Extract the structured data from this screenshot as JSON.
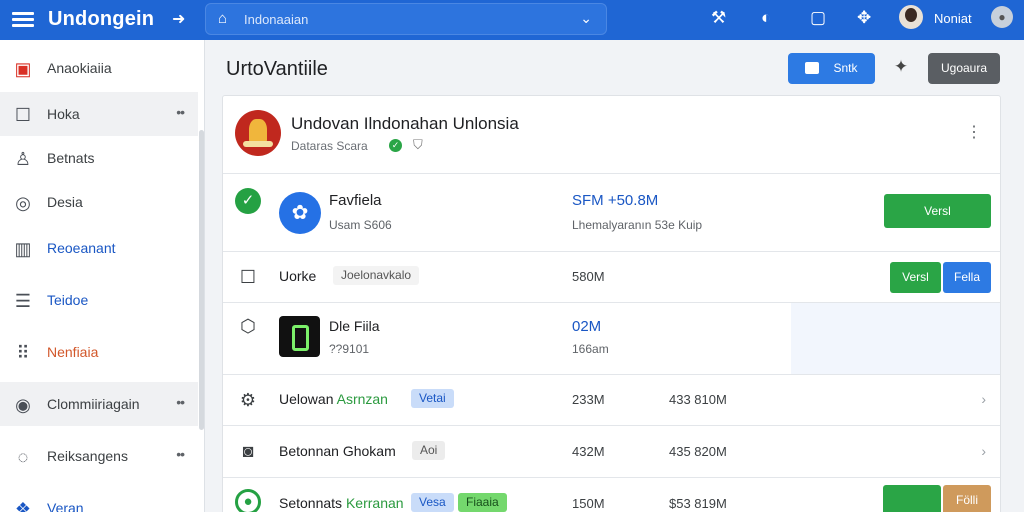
{
  "app": {
    "title": "Undongein",
    "search_text": "Indonaaian",
    "user_name": "Noniat"
  },
  "sidebar": {
    "items": [
      {
        "label": "Anaokiaiia",
        "icon": "flag-icon"
      },
      {
        "label": "Hoka",
        "icon": "square-icon",
        "more": "••"
      },
      {
        "label": "Betnats",
        "icon": "person-icon"
      },
      {
        "label": "Desia",
        "icon": "eye-icon"
      },
      {
        "label": "Reoeanant",
        "icon": "bar-chart-icon"
      },
      {
        "label": "Teidoe",
        "icon": "list-icon"
      },
      {
        "label": "Nenfiaia",
        "icon": "grid-icon"
      },
      {
        "label": "Clommiiriagain",
        "icon": "person-circle-icon",
        "more": "••"
      },
      {
        "label": "Reiksangens",
        "icon": "chat-icon",
        "more": "••"
      },
      {
        "label": "Veran",
        "icon": "tag-icon"
      }
    ]
  },
  "page": {
    "title": "UrtoVantiile",
    "primary_button": "Sntk",
    "dark_button": "Ugoaura"
  },
  "org": {
    "name": "Undovan Ilndonahan Unlonsia",
    "subtitle": "Dataras Scara"
  },
  "rows": [
    {
      "name": "Favfiela",
      "sub": "Usam S606",
      "value": "SFM +50.8M",
      "value_sub": "Lhemalyaranın 53e Kuip",
      "action": "Versl"
    },
    {
      "name": "Uorke",
      "tag": "Joelonavkalo",
      "value": "580M",
      "actions": [
        "Versl",
        "Fella"
      ]
    },
    {
      "name": "Dle Fiila",
      "sub": "??9101",
      "value": "02M",
      "value_sub": "166am"
    },
    {
      "name": "Uelowan",
      "name_green": "Asrnzan",
      "tag": "Vetai",
      "value": "233M",
      "value2": "433 810M"
    },
    {
      "name": "Betonnan Ghokam",
      "tag": "Aoi",
      "value": "432M",
      "value2": "435 820M"
    },
    {
      "name": "Setonnats",
      "name_green": "Kerranan",
      "tags": [
        "Vesa",
        "Fiaaia"
      ],
      "value": "150M",
      "value2": "$53 819M",
      "action2": "Fölli"
    }
  ],
  "colors": {
    "topbar": "#1f66d4",
    "primary": "#2d7ae3",
    "green": "#2aa546",
    "dark_button": "#5a5e63"
  }
}
